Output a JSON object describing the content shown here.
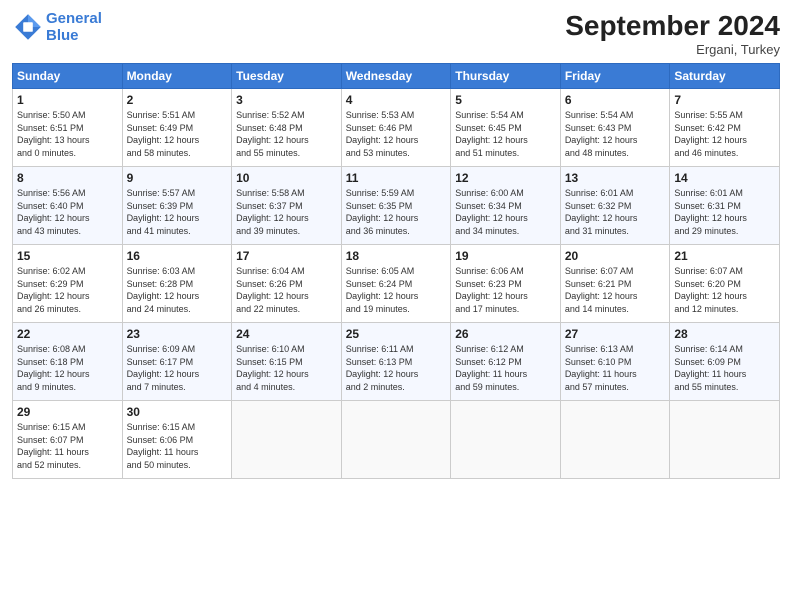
{
  "header": {
    "logo_line1": "General",
    "logo_line2": "Blue",
    "month_title": "September 2024",
    "subtitle": "Ergani, Turkey"
  },
  "weekdays": [
    "Sunday",
    "Monday",
    "Tuesday",
    "Wednesday",
    "Thursday",
    "Friday",
    "Saturday"
  ],
  "weeks": [
    [
      {
        "day": "1",
        "info": "Sunrise: 5:50 AM\nSunset: 6:51 PM\nDaylight: 13 hours\nand 0 minutes."
      },
      {
        "day": "2",
        "info": "Sunrise: 5:51 AM\nSunset: 6:49 PM\nDaylight: 12 hours\nand 58 minutes."
      },
      {
        "day": "3",
        "info": "Sunrise: 5:52 AM\nSunset: 6:48 PM\nDaylight: 12 hours\nand 55 minutes."
      },
      {
        "day": "4",
        "info": "Sunrise: 5:53 AM\nSunset: 6:46 PM\nDaylight: 12 hours\nand 53 minutes."
      },
      {
        "day": "5",
        "info": "Sunrise: 5:54 AM\nSunset: 6:45 PM\nDaylight: 12 hours\nand 51 minutes."
      },
      {
        "day": "6",
        "info": "Sunrise: 5:54 AM\nSunset: 6:43 PM\nDaylight: 12 hours\nand 48 minutes."
      },
      {
        "day": "7",
        "info": "Sunrise: 5:55 AM\nSunset: 6:42 PM\nDaylight: 12 hours\nand 46 minutes."
      }
    ],
    [
      {
        "day": "8",
        "info": "Sunrise: 5:56 AM\nSunset: 6:40 PM\nDaylight: 12 hours\nand 43 minutes."
      },
      {
        "day": "9",
        "info": "Sunrise: 5:57 AM\nSunset: 6:39 PM\nDaylight: 12 hours\nand 41 minutes."
      },
      {
        "day": "10",
        "info": "Sunrise: 5:58 AM\nSunset: 6:37 PM\nDaylight: 12 hours\nand 39 minutes."
      },
      {
        "day": "11",
        "info": "Sunrise: 5:59 AM\nSunset: 6:35 PM\nDaylight: 12 hours\nand 36 minutes."
      },
      {
        "day": "12",
        "info": "Sunrise: 6:00 AM\nSunset: 6:34 PM\nDaylight: 12 hours\nand 34 minutes."
      },
      {
        "day": "13",
        "info": "Sunrise: 6:01 AM\nSunset: 6:32 PM\nDaylight: 12 hours\nand 31 minutes."
      },
      {
        "day": "14",
        "info": "Sunrise: 6:01 AM\nSunset: 6:31 PM\nDaylight: 12 hours\nand 29 minutes."
      }
    ],
    [
      {
        "day": "15",
        "info": "Sunrise: 6:02 AM\nSunset: 6:29 PM\nDaylight: 12 hours\nand 26 minutes."
      },
      {
        "day": "16",
        "info": "Sunrise: 6:03 AM\nSunset: 6:28 PM\nDaylight: 12 hours\nand 24 minutes."
      },
      {
        "day": "17",
        "info": "Sunrise: 6:04 AM\nSunset: 6:26 PM\nDaylight: 12 hours\nand 22 minutes."
      },
      {
        "day": "18",
        "info": "Sunrise: 6:05 AM\nSunset: 6:24 PM\nDaylight: 12 hours\nand 19 minutes."
      },
      {
        "day": "19",
        "info": "Sunrise: 6:06 AM\nSunset: 6:23 PM\nDaylight: 12 hours\nand 17 minutes."
      },
      {
        "day": "20",
        "info": "Sunrise: 6:07 AM\nSunset: 6:21 PM\nDaylight: 12 hours\nand 14 minutes."
      },
      {
        "day": "21",
        "info": "Sunrise: 6:07 AM\nSunset: 6:20 PM\nDaylight: 12 hours\nand 12 minutes."
      }
    ],
    [
      {
        "day": "22",
        "info": "Sunrise: 6:08 AM\nSunset: 6:18 PM\nDaylight: 12 hours\nand 9 minutes."
      },
      {
        "day": "23",
        "info": "Sunrise: 6:09 AM\nSunset: 6:17 PM\nDaylight: 12 hours\nand 7 minutes."
      },
      {
        "day": "24",
        "info": "Sunrise: 6:10 AM\nSunset: 6:15 PM\nDaylight: 12 hours\nand 4 minutes."
      },
      {
        "day": "25",
        "info": "Sunrise: 6:11 AM\nSunset: 6:13 PM\nDaylight: 12 hours\nand 2 minutes."
      },
      {
        "day": "26",
        "info": "Sunrise: 6:12 AM\nSunset: 6:12 PM\nDaylight: 11 hours\nand 59 minutes."
      },
      {
        "day": "27",
        "info": "Sunrise: 6:13 AM\nSunset: 6:10 PM\nDaylight: 11 hours\nand 57 minutes."
      },
      {
        "day": "28",
        "info": "Sunrise: 6:14 AM\nSunset: 6:09 PM\nDaylight: 11 hours\nand 55 minutes."
      }
    ],
    [
      {
        "day": "29",
        "info": "Sunrise: 6:15 AM\nSunset: 6:07 PM\nDaylight: 11 hours\nand 52 minutes."
      },
      {
        "day": "30",
        "info": "Sunrise: 6:15 AM\nSunset: 6:06 PM\nDaylight: 11 hours\nand 50 minutes."
      },
      {
        "day": "",
        "info": ""
      },
      {
        "day": "",
        "info": ""
      },
      {
        "day": "",
        "info": ""
      },
      {
        "day": "",
        "info": ""
      },
      {
        "day": "",
        "info": ""
      }
    ]
  ]
}
